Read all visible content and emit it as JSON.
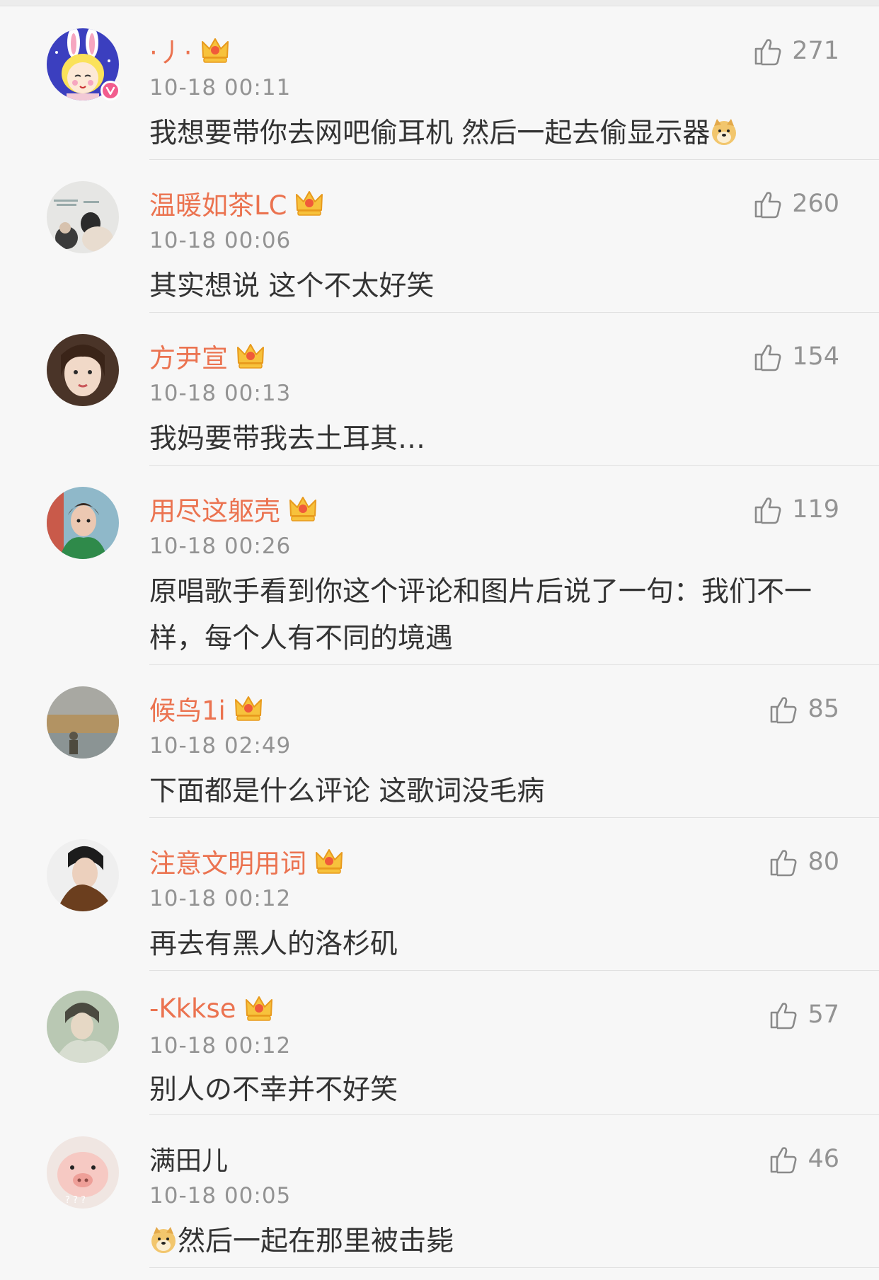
{
  "comments": [
    {
      "user": "·丿·",
      "time": "10-18 00:11",
      "text": "我想要带你去网吧偷耳机 然后一起去偷显示器",
      "emoji_after": "doge-emoji",
      "likes": "271",
      "crown": true,
      "verified": true
    },
    {
      "user": "温暖如茶LC",
      "time": "10-18 00:06",
      "text": "其实想说 这个不太好笑",
      "likes": "260",
      "crown": true
    },
    {
      "user": "方尹宣",
      "time": "10-18 00:13",
      "text": "我妈要带我去土耳其…",
      "likes": "154",
      "crown": true
    },
    {
      "user": "用尽这躯壳",
      "time": "10-18 00:26",
      "text": "原唱歌手看到你这个评论和图片后说了一句：我们不一样，每个人有不同的境遇",
      "likes": "119",
      "crown": true
    },
    {
      "user": "候鸟1i",
      "time": "10-18 02:49",
      "text": "下面都是什么评论 这歌词没毛病",
      "likes": "85",
      "crown": true
    },
    {
      "user": "注意文明用词",
      "time": "10-18 00:12",
      "text": "再去有黑人的洛杉矶",
      "likes": "80",
      "crown": true
    },
    {
      "user": "-Kkkse",
      "time": "10-18 00:12",
      "text": "别人の不幸并不好笑",
      "likes": "57",
      "crown": true
    },
    {
      "user": "满田儿",
      "time": "10-18 00:05",
      "text": "然后一起在那里被击毙",
      "emoji_before": "doge-emoji",
      "likes": "46",
      "crown": false
    }
  ],
  "icons": {
    "like": "thumbs-up-icon",
    "crown": "member-crown-icon",
    "emoji": "doge-emoji"
  },
  "colors": {
    "username": "#eb7350",
    "time": "#939393",
    "text": "#333333",
    "background": "#f7f7f7"
  }
}
